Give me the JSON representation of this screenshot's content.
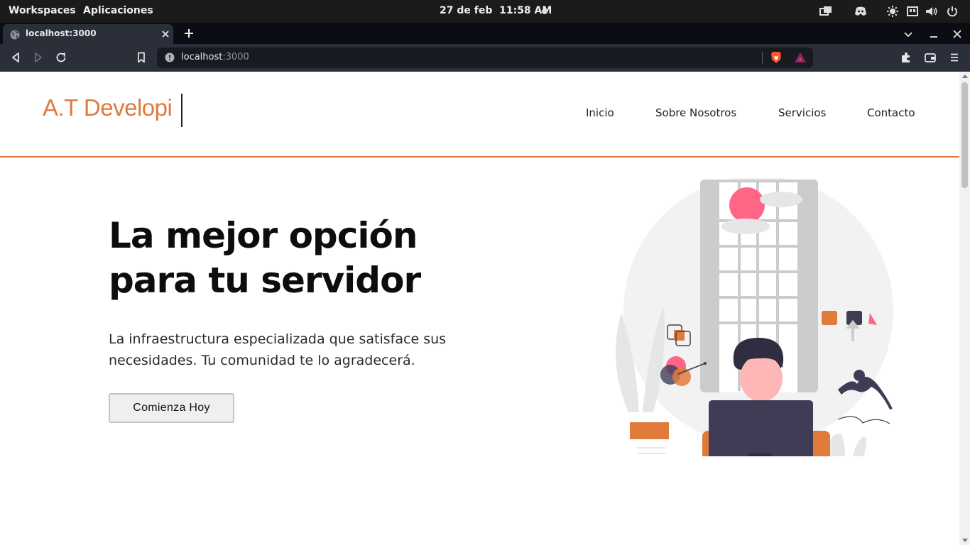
{
  "os_bar": {
    "workspaces": "Workspaces",
    "applications": "Aplicaciones",
    "date": "27 de feb",
    "time": "11:58 AM"
  },
  "browser": {
    "tab_title": "localhost:3000",
    "url_host": "localhost",
    "url_port": ":3000"
  },
  "site": {
    "logo": "A.T Developi",
    "nav": [
      "Inicio",
      "Sobre Nosotros",
      "Servicios",
      "Contacto"
    ],
    "hero_title_line1": "La mejor opción",
    "hero_title_line2": "para tu servidor",
    "hero_sub_line1": "La infraestructura especializada que satisface sus",
    "hero_sub_line2": "necesidades. Tu comunidad te lo agradecerá.",
    "cta": "Comienza Hoy"
  },
  "colors": {
    "accent": "#e07b3c",
    "os_bar": "#1b1b1b",
    "browser_toolbar": "#2b2f3a",
    "illustration_pink": "#ff6584",
    "illustration_dark": "#3f3d56"
  },
  "icons": [
    "windows-icon",
    "discord-icon",
    "brightness-icon",
    "display-icon",
    "volume-icon",
    "power-icon",
    "globe-icon",
    "close-icon",
    "plus-icon",
    "chevron-down-icon",
    "minimize-icon",
    "back-icon",
    "forward-icon",
    "reload-icon",
    "bookmark-icon",
    "info-icon",
    "brave-shield-icon",
    "brave-rewards-icon",
    "extensions-icon",
    "wallet-icon",
    "menu-icon"
  ]
}
